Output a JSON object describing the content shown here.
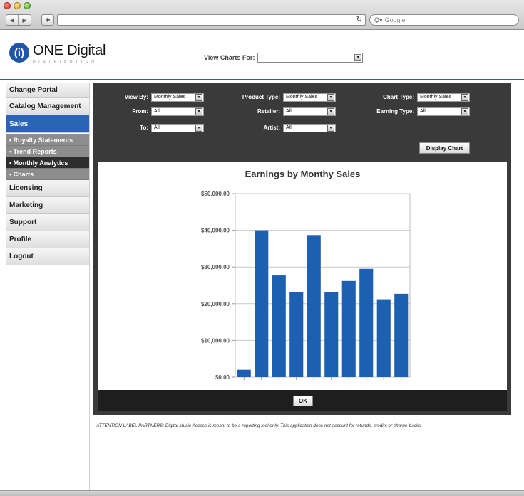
{
  "browser": {
    "search_placeholder": "Google",
    "back_label": "◀",
    "forward_label": "▶",
    "new_tab_label": "+"
  },
  "logo": {
    "mark": "(i)",
    "title": "ONE Digital",
    "subtitle": "DISTRIBUTION"
  },
  "header": {
    "view_charts_label": "View Charts For:",
    "view_charts_value": ""
  },
  "sidebar": {
    "items": [
      {
        "label": "Change Portal"
      },
      {
        "label": "Catalog Management"
      },
      {
        "label": "Sales"
      },
      {
        "label": "Licensing"
      },
      {
        "label": "Marketing"
      },
      {
        "label": "Support"
      },
      {
        "label": "Profile"
      },
      {
        "label": "Logout"
      }
    ],
    "sub_items": [
      {
        "label": "• Royalty Statements"
      },
      {
        "label": "• Trend Reports"
      },
      {
        "label": "• Monthly Analytics"
      },
      {
        "label": "• Charts"
      }
    ]
  },
  "filters": {
    "view_by": {
      "label": "View By:",
      "value": "Monthly Sales"
    },
    "from": {
      "label": "From:",
      "value": "All"
    },
    "to": {
      "label": "To:",
      "value": "All"
    },
    "product_type": {
      "label": "Product Type:",
      "value": "Monthly Sales"
    },
    "retailer": {
      "label": "Retailer:",
      "value": "All"
    },
    "artist": {
      "label": "Artist:",
      "value": "All"
    },
    "chart_type": {
      "label": "Chart Type:",
      "value": "Monthly Sales"
    },
    "earning_type": {
      "label": "Earning Type:",
      "value": "All"
    },
    "display_button": "Display Chart"
  },
  "chart_data": {
    "type": "bar",
    "title": "Earnings by Monthy Sales",
    "xlabel": "",
    "ylabel": "",
    "ylim": [
      0,
      50000
    ],
    "ticks": [
      "$0.00",
      "$10,000.00",
      "$20,000.00",
      "$30,000.00",
      "$40,000.00",
      "$50,000.00"
    ],
    "tick_values": [
      0,
      10000,
      20000,
      30000,
      40000,
      50000
    ],
    "values": [
      2000,
      40000,
      27700,
      23200,
      38700,
      23200,
      26200,
      29500,
      21200,
      22700
    ],
    "bar_color": "#1d5fb0",
    "grid": true
  },
  "ok_label": "OK",
  "attention": "ATTENTION LABEL PARTNERS: Digital Music Access is meant to be a reporting tool only. This application does not account for refunds, credits or charge-backs."
}
